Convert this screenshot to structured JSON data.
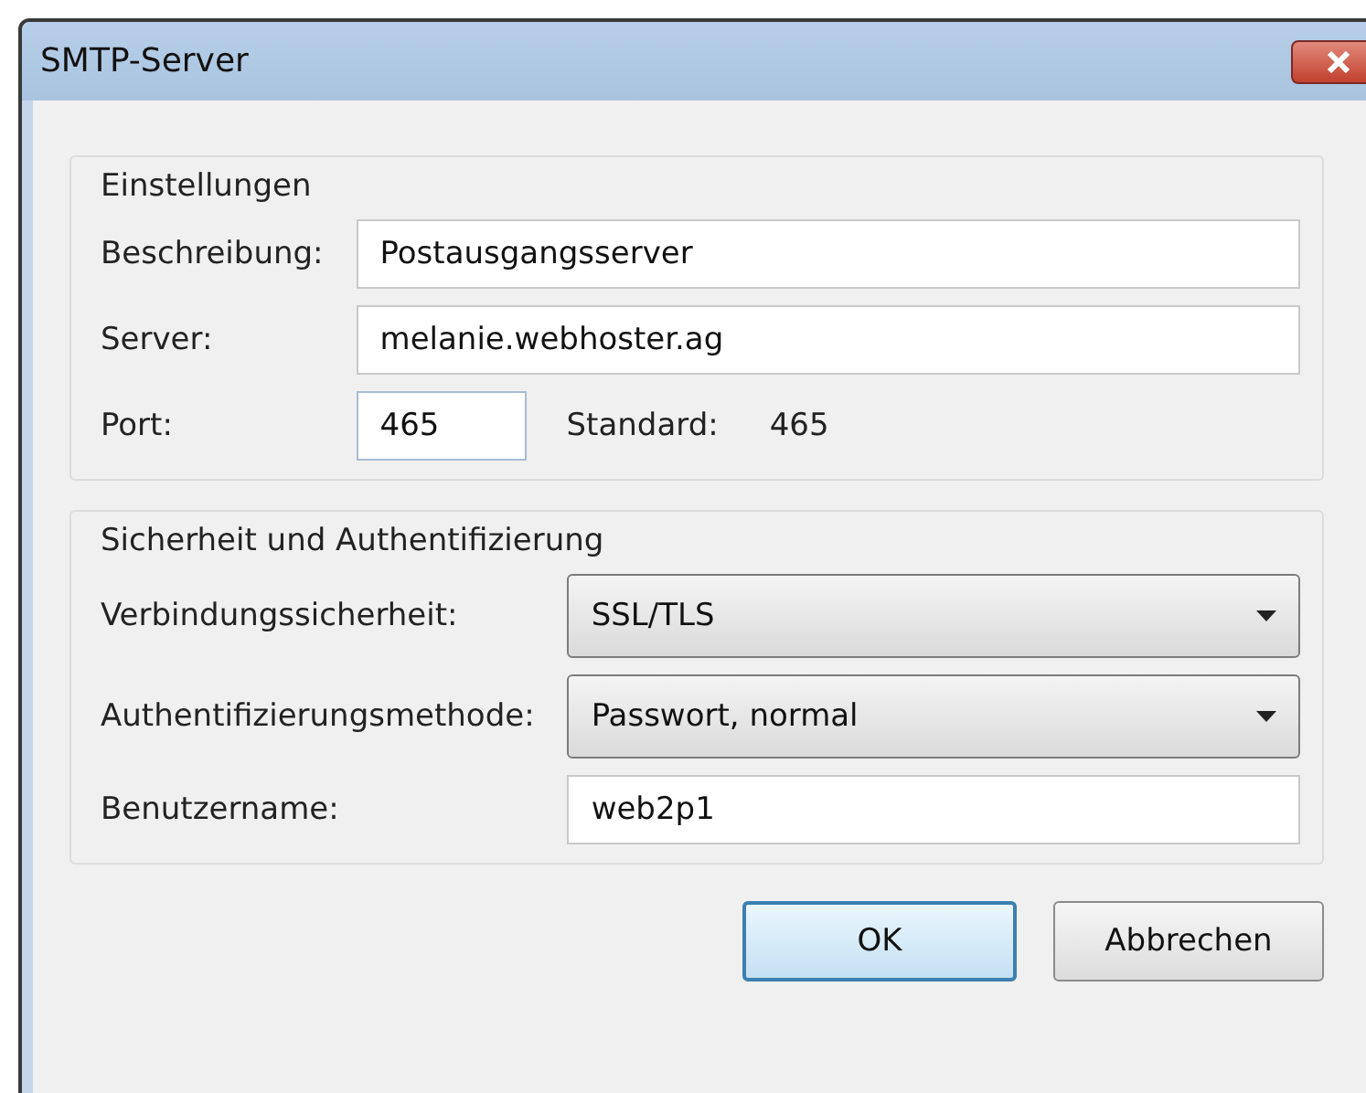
{
  "window": {
    "title": "SMTP-Server"
  },
  "groups": [
    {
      "legend": "Einstellungen",
      "rows": [
        {
          "kind": "text",
          "label": "Beschreibung:",
          "value": "Postausgangsserver"
        },
        {
          "kind": "text",
          "label": "Server:",
          "value": "melanie.webhoster.ag"
        },
        {
          "kind": "port",
          "label": "Port:",
          "value": "465",
          "default_label": "Standard:",
          "default_value": "465"
        }
      ]
    },
    {
      "legend": "Sicherheit und Authentifizierung",
      "rows": [
        {
          "kind": "dropdown",
          "label": "Verbindungssicherheit:",
          "value": "SSL/TLS"
        },
        {
          "kind": "dropdown",
          "label": "Authentifizierungsmethode:",
          "value": "Passwort, normal"
        },
        {
          "kind": "text",
          "label": "Benutzername:",
          "value": "web2p1"
        }
      ]
    }
  ],
  "buttons": [
    {
      "label": "OK",
      "default": true
    },
    {
      "label": "Abbrechen",
      "default": false
    }
  ]
}
